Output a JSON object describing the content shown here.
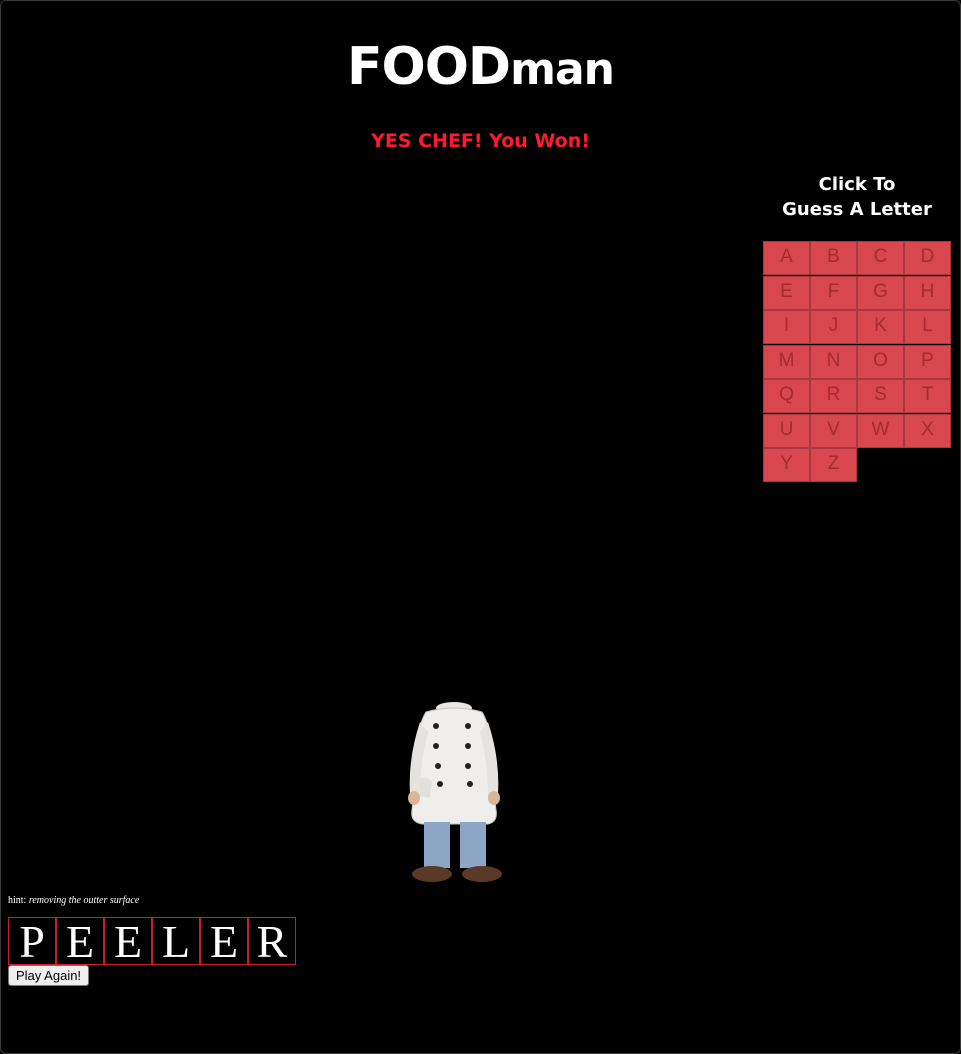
{
  "header": {
    "title_bold": "FOOD",
    "title_rest": "man"
  },
  "status_message": "YES CHEF! You Won!",
  "keyboard": {
    "heading_line1": "Click To",
    "heading_line2": "Guess A Letter",
    "keys": [
      "A",
      "B",
      "C",
      "D",
      "E",
      "F",
      "G",
      "H",
      "I",
      "J",
      "K",
      "L",
      "M",
      "N",
      "O",
      "P",
      "Q",
      "R",
      "S",
      "T",
      "U",
      "V",
      "W",
      "X",
      "Y",
      "Z"
    ],
    "key_color": "#d9474e"
  },
  "hint": {
    "label": "hint:",
    "text": "removing the outter surface"
  },
  "word": {
    "letters": [
      "P",
      "E",
      "E",
      "L",
      "E",
      "R"
    ]
  },
  "play_again_label": "Play Again!",
  "colors": {
    "background": "#000000",
    "status": "#ff1a2e",
    "letter_border": "#cc1b2a"
  },
  "figure_icon": "headless-chef-figure"
}
